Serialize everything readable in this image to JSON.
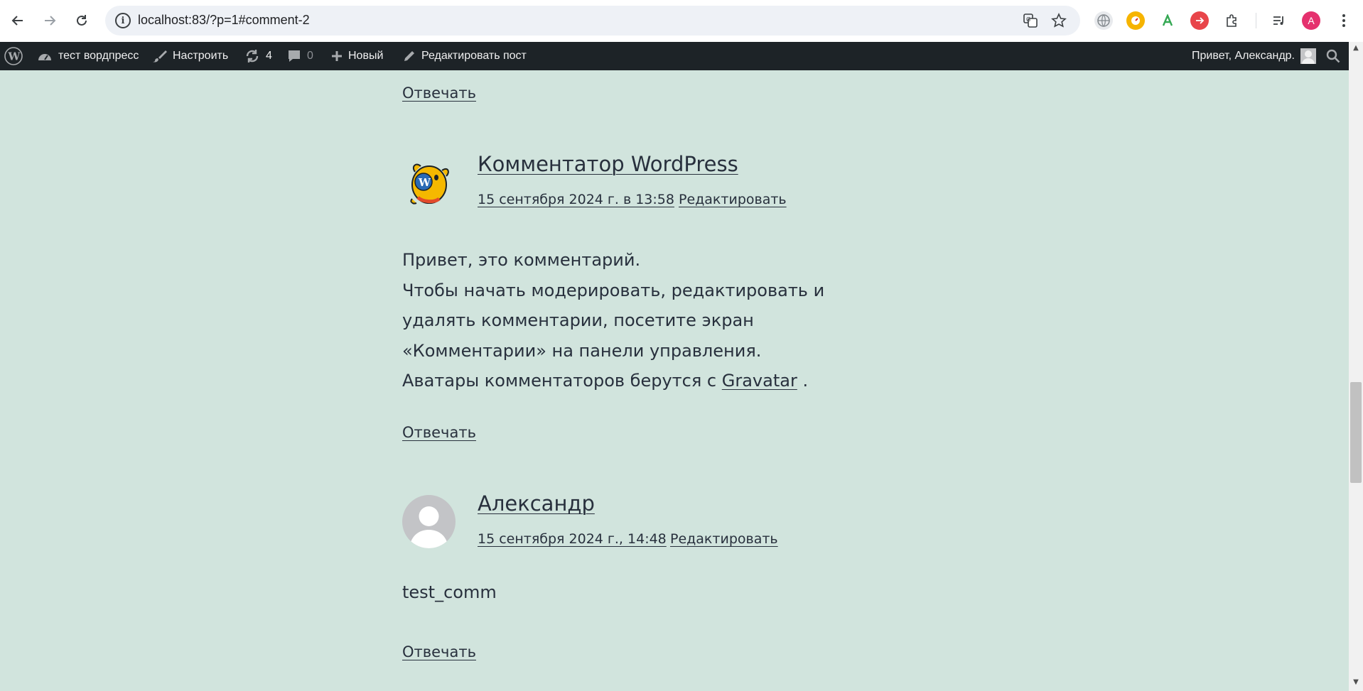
{
  "browser": {
    "url": "localhost:83/?p=1#comment-2",
    "profile_initial": "A"
  },
  "adminbar": {
    "site_name": "тест вордпресс",
    "customize_label": "Настроить",
    "updates_count": "4",
    "comments_count": "0",
    "new_label": "Новый",
    "edit_post_label": "Редактировать пост",
    "greeting": "Привет, Александр."
  },
  "comments": {
    "top_reply": "Отвечать",
    "c1": {
      "author": "Комментатор WordPress",
      "date": "15 сентября 2024 г. в 13:58",
      "edit": "Редактировать",
      "line1": "Привет, это комментарий.",
      "line2": "Чтобы начать модерировать, редактировать и удалять комментарии, посетите экран «Комментарии» на панели управления.",
      "line3_prefix": "Аватары комментаторов берутся с",
      "line3_link": "Gravatar",
      "line3_suffix": ".",
      "reply": "Отвечать"
    },
    "c2": {
      "author": "Александр",
      "date": "15 сентября 2024 г., 14:48",
      "edit": "Редактировать",
      "text": "test_comm",
      "reply": "Отвечать"
    }
  },
  "colors": {
    "page_bg": "#d1e4dd",
    "text": "#28303d",
    "adminbar_bg": "#1d2327"
  }
}
